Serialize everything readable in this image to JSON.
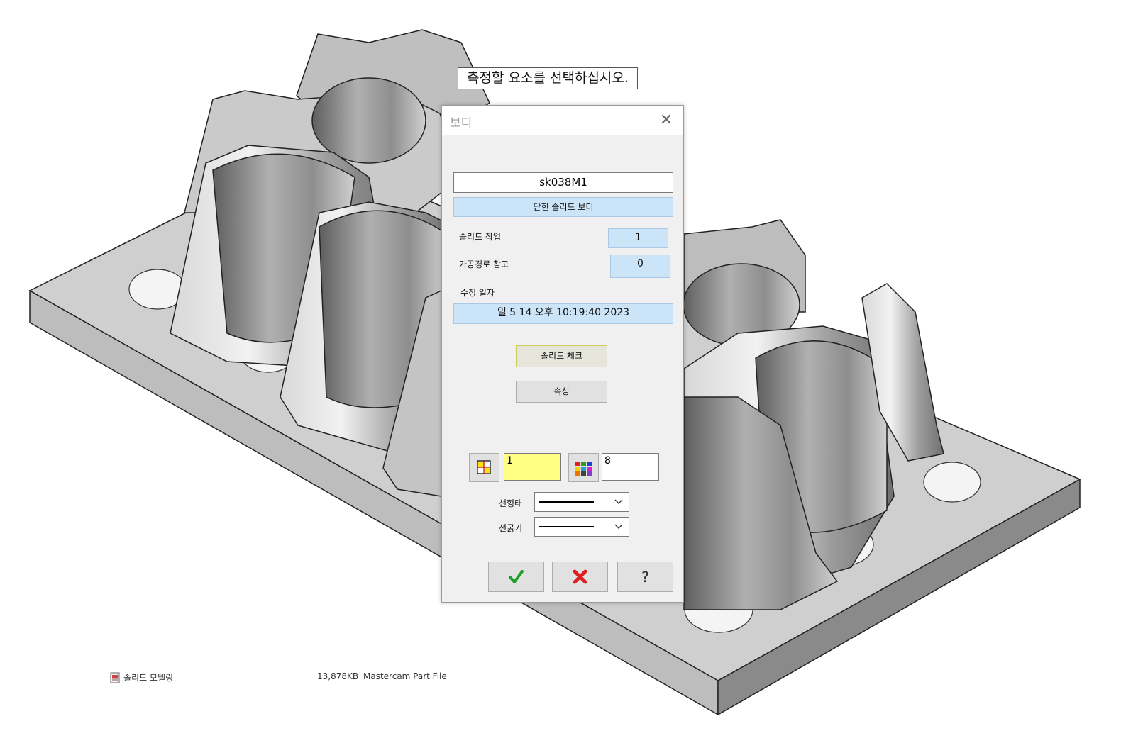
{
  "prompt": {
    "text": "측정할 요소를 선택하십시오."
  },
  "dialog": {
    "title": "보디",
    "body_name": "sk038M1",
    "body_type": "닫힌 솔리드 보디",
    "solid_ops_label": "솔리드 작업",
    "solid_ops_value": "1",
    "toolpath_ref_label": "가공경로 참고",
    "toolpath_ref_value": "0",
    "modified_date_label": "수정 일자",
    "modified_date_value": "일 5 14 오후 10:19:40 2023",
    "solid_check_label": "솔리드 체크",
    "properties_label": "속성",
    "level_value": "1",
    "color_value": "8",
    "line_style_label": "선형태",
    "line_width_label": "선굵기"
  },
  "file_row": {
    "name": "솔리드 모델링",
    "size": "13,878KB",
    "type": "Mastercam Part File"
  },
  "colors": {
    "accent_blue": "#cce4f7",
    "level_yellow": "#ffff86",
    "ok_green": "#1f9e2a",
    "cancel_red": "#e02020"
  },
  "icons": [
    "close-icon",
    "level-icon",
    "color-palette-icon",
    "chevron-down-icon",
    "checkmark-icon",
    "cross-icon",
    "question-icon",
    "file-icon"
  ]
}
